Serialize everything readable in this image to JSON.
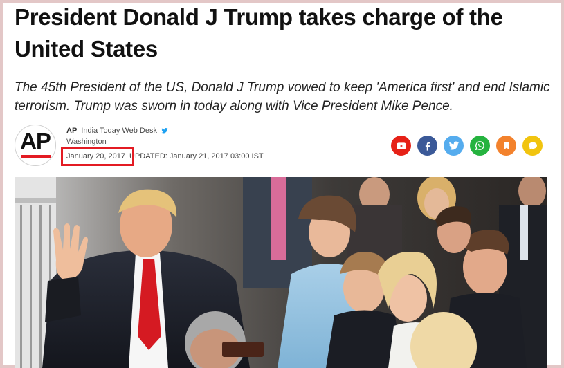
{
  "article": {
    "headline": "President Donald J Trump takes charge of the United States",
    "summary": "The 45th President of the US, Donald J Trump vowed to keep 'America first' and end Islamic terrorism. Trump was sworn in today along with Vice President Mike Pence."
  },
  "author": {
    "logo_text": "AP",
    "source": "AP",
    "desk": "India Today Web Desk",
    "location": "Washington",
    "published": "January 20, 2017",
    "updated": "UPDATED: January 21, 2017 03:00 IST"
  },
  "share": [
    {
      "icon": "youtube-icon",
      "color": "#e62117"
    },
    {
      "icon": "facebook-icon",
      "color": "#3b5998"
    },
    {
      "icon": "twitter-icon",
      "color": "#55acee"
    },
    {
      "icon": "whatsapp-icon",
      "color": "#25b33f"
    },
    {
      "icon": "bookmark-icon",
      "color": "#f3822d"
    },
    {
      "icon": "comment-icon",
      "color": "#f1c40f"
    }
  ],
  "colors": {
    "highlight": "#e31b23",
    "twitter_badge": "#1da1f2"
  }
}
